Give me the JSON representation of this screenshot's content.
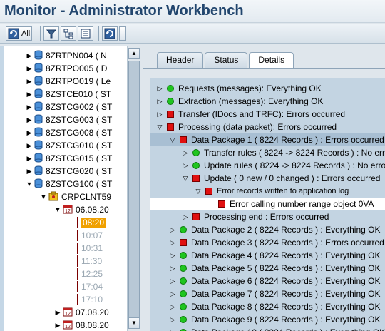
{
  "window": {
    "title": "Monitor - Administrator Workbench"
  },
  "toolbar": {
    "all_label": "All"
  },
  "left_tree": {
    "items": [
      {
        "label": "8ZRTPN004 ( N"
      },
      {
        "label": "8ZRTPO005 ( D"
      },
      {
        "label": "8ZRTPO019 ( Le"
      },
      {
        "label": "8ZSTCE010 ( ST"
      },
      {
        "label": "8ZSTCG002 ( ST"
      },
      {
        "label": "8ZSTCG003 ( ST"
      },
      {
        "label": "8ZSTCG008 ( ST"
      },
      {
        "label": "8ZSTCG010 ( ST"
      },
      {
        "label": "8ZSTCG015 ( ST"
      },
      {
        "label": "8ZSTCG020 ( ST"
      },
      {
        "label": "8ZSTCG100 ( ST"
      },
      {
        "label": "CRPCLNT59"
      },
      {
        "label": "06.08.20"
      },
      {
        "label": "08:20"
      },
      {
        "label": "10:07"
      },
      {
        "label": "10:31"
      },
      {
        "label": "11:30"
      },
      {
        "label": "12:25"
      },
      {
        "label": "17:04"
      },
      {
        "label": "17:10"
      },
      {
        "label": "07.08.20"
      },
      {
        "label": "08.08.20"
      }
    ]
  },
  "tabs": [
    {
      "label": "Header"
    },
    {
      "label": "Status"
    },
    {
      "label": "Details"
    }
  ],
  "details": {
    "rows": [
      {
        "label": "Requests (messages): Everything OK"
      },
      {
        "label": "Extraction (messages): Everything OK"
      },
      {
        "label": "Transfer (IDocs and TRFC): Errors occurred"
      },
      {
        "label": "Processing (data packet): Errors occurred"
      },
      {
        "label": "Data Package 1 ( 8224 Records ) : Errors occurred"
      },
      {
        "label": "Transfer rules ( 8224 -> 8224 Records ) : No errors"
      },
      {
        "label": "Update rules ( 8224 -> 8224 Records ) : No errors"
      },
      {
        "label": "Update ( 0 new / 0 changed ) : Errors occurred"
      },
      {
        "label": "Error records written to application log"
      },
      {
        "label": "Error calling number range object 0VA"
      },
      {
        "label": "Processing end : Errors occurred"
      },
      {
        "label": "Data Package 2 ( 8224 Records ) : Everything OK"
      },
      {
        "label": "Data Package 3 ( 8224 Records ) : Errors occurred"
      },
      {
        "label": "Data Package 4 ( 8224 Records ) : Everything OK"
      },
      {
        "label": "Data Package 5 ( 8224 Records ) : Everything OK"
      },
      {
        "label": "Data Package 6 ( 8224 Records ) : Everything OK"
      },
      {
        "label": "Data Package 7 ( 8224 Records ) : Everything OK"
      },
      {
        "label": "Data Package 8 ( 8224 Records ) : Everything OK"
      },
      {
        "label": "Data Package 9 ( 8224 Records ) : Everything OK"
      },
      {
        "label": "Data Package 10 ( 8224 Records ) : Everything OK"
      }
    ]
  }
}
